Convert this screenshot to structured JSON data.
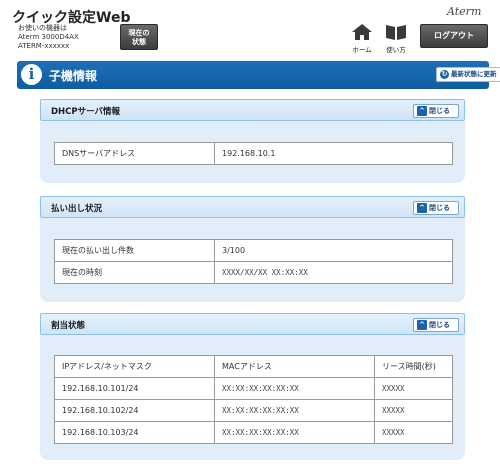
{
  "header": {
    "app_title": "クイック設定Web",
    "device_lines": [
      "お使いの機器は",
      "Aterm 3000D4AX",
      "ATERM-xxxxxx"
    ],
    "status_button": [
      "現在の",
      "状態"
    ],
    "home_label": "ホーム",
    "help_label": "使い方",
    "logo": "Aterm",
    "logout_label": "ログアウト"
  },
  "page": {
    "title": "子機情報",
    "refresh_label": "最新状態に更新"
  },
  "sections": [
    {
      "title": "DHCPサーバ情報",
      "close_label": "閉じる",
      "rows": [
        [
          "DNSサーバアドレス",
          "192.168.10.1"
        ]
      ]
    },
    {
      "title": "払い出し状況",
      "close_label": "閉じる",
      "rows": [
        [
          "現在の払い出し件数",
          "3/100"
        ],
        [
          "現在の時刻",
          "XXXX/XX/XX XX:XX:XX"
        ]
      ]
    },
    {
      "title": "割当状態",
      "close_label": "閉じる",
      "headers": [
        "IPアドレス/ネットマスク",
        "MACアドレス",
        "リース時間(秒)"
      ],
      "rows": [
        [
          "192.168.10.101/24",
          "XX:XX:XX:XX:XX:XX",
          "XXXXX"
        ],
        [
          "192.168.10.102/24",
          "XX:XX:XX:XX:XX:XX",
          "XXXXX"
        ],
        [
          "192.168.10.103/24",
          "XX:XX:XX:XX:XX:XX",
          "XXXXX"
        ]
      ]
    }
  ]
}
